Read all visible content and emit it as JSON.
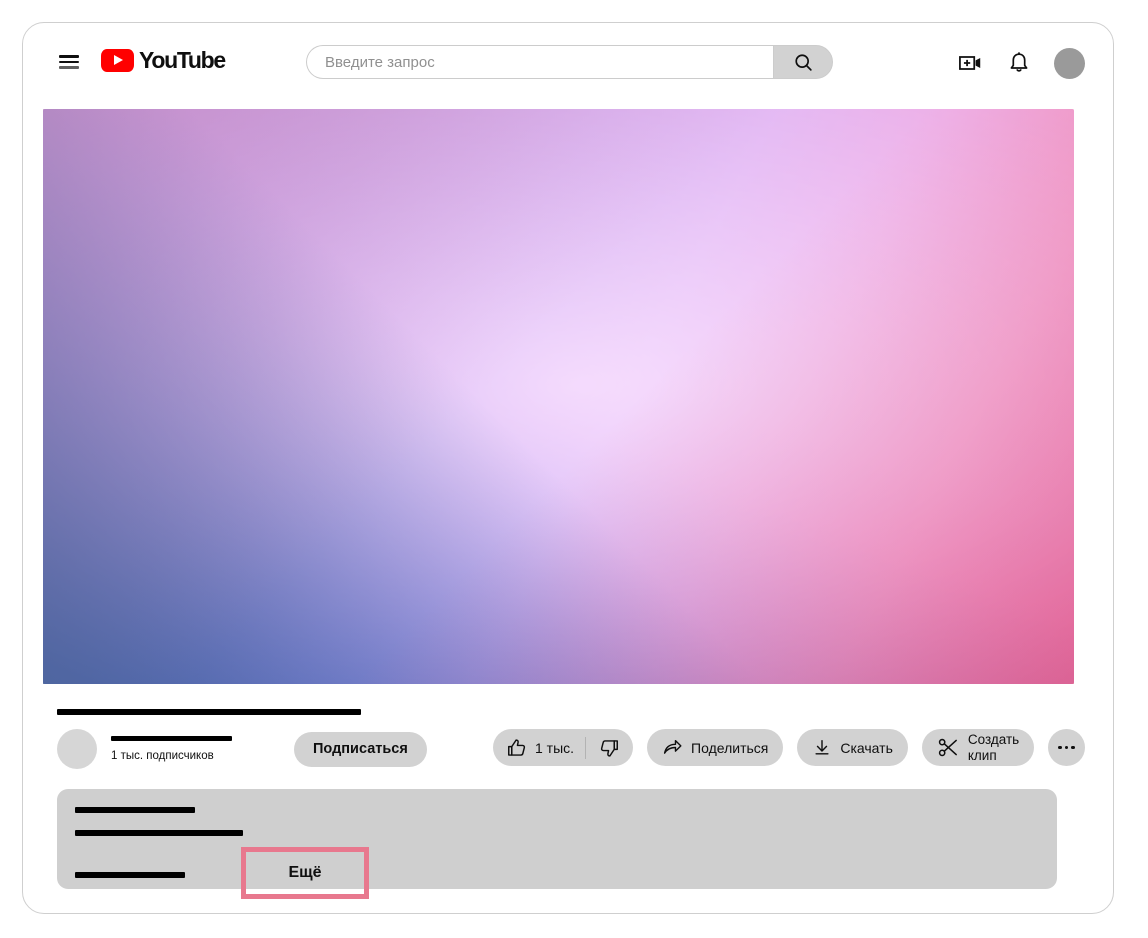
{
  "app": {
    "name": "YouTube",
    "logo_text": "YouTube"
  },
  "masthead": {
    "menu_icon": "hamburger-menu-icon",
    "logo_label": "YouTube",
    "search": {
      "placeholder": "Введите запрос",
      "value": "",
      "button_icon": "search-icon"
    },
    "icons": [
      {
        "name": "create-video-icon",
        "label": "Создать"
      },
      {
        "name": "notifications-bell-icon",
        "label": "Уведомления"
      }
    ],
    "avatar": {
      "name": "account-avatar",
      "color": "#9a9a9a"
    }
  },
  "player": {
    "state": "redacted-gradient",
    "gradient_colors": {
      "top_left": "#8a7ba0",
      "top_right": "#efa0ce",
      "center": "#d3a6e6",
      "bottom_left": "#4d6a9a",
      "bottom_right": "#e2647a"
    }
  },
  "video": {
    "title_redacted": true,
    "channel": {
      "name_redacted": true,
      "subscribers": "1 тыс. подписчиков",
      "subscribe_label": "Подписаться"
    }
  },
  "actions": {
    "like": {
      "label": "1 тыс.",
      "icon": "thumbs-up-icon"
    },
    "dislike": {
      "label": "",
      "icon": "thumbs-down-icon"
    },
    "share": {
      "label": "Поделиться",
      "icon": "share-arrow-icon"
    },
    "download": {
      "label": "Скачать",
      "icon": "download-icon"
    },
    "clip": {
      "label_line1": "Создать",
      "label_line2": "клип",
      "icon": "scissors-icon"
    },
    "more": {
      "label": "",
      "icon": "more-horizontal-icon"
    }
  },
  "description": {
    "lines_redacted": 3,
    "more_button": {
      "label": "Ещё",
      "highlighted": true,
      "highlight_color": "#e8788e"
    }
  }
}
